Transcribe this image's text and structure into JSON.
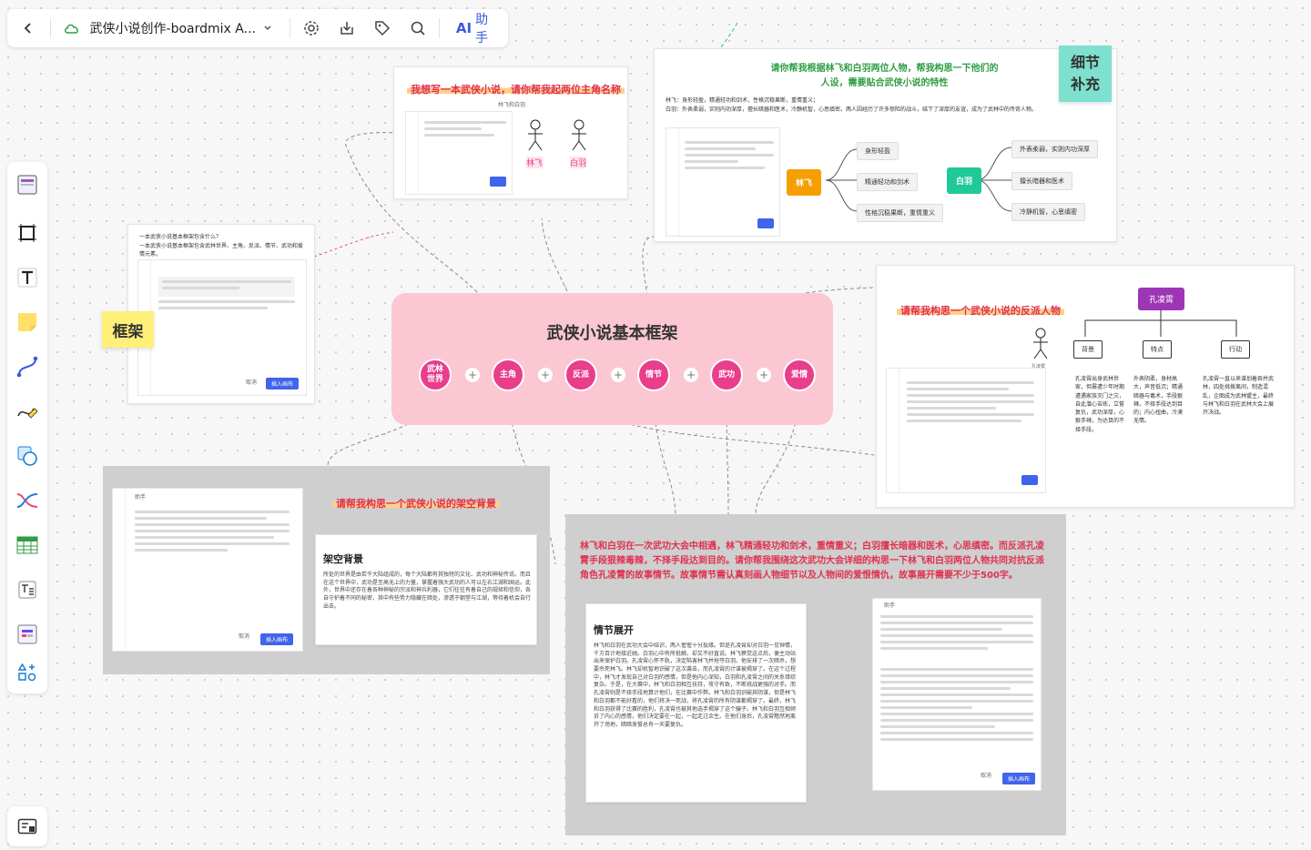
{
  "toolbar": {
    "back_icon": "chevron-left-icon",
    "cloud_icon": "cloud-icon",
    "title": "武侠小说创作-boardmix A...",
    "ai_logo": "AI",
    "ai_label": "助手"
  },
  "left_tools": [
    "template-icon",
    "frame-icon",
    "text-icon",
    "sticky-note-icon",
    "connector-icon",
    "pen-icon",
    "shape-icon",
    "mindmap-icon",
    "table-icon",
    "text-list-icon",
    "image-icon",
    "more-shapes-icon"
  ],
  "bottom_tool_icon": "map-view-icon",
  "main_frame": {
    "title": "武侠小说基本框架",
    "nodes": [
      "武林\n世界",
      "主角",
      "反派",
      "情节",
      "武功",
      "爱情"
    ],
    "plus": "+"
  },
  "sticky_kuangjia": "框架",
  "sticky_xijie": "细节\n补充",
  "card_names": {
    "highlight": "我想写一本武侠小说，请你帮我起两位主角名称",
    "subtitle": "林飞和白羽",
    "char1": "林飞",
    "char2": "白羽"
  },
  "card_framework": {
    "q1": "一本武侠小说基本框架包含什么？",
    "q2": "一本武侠小说基本框架包含武林世界、主角、反派、情节、武功和爱情元素。",
    "cancel": "取消",
    "insert": "插入画布"
  },
  "card_detail": {
    "highlight_line1": "请你帮我根据林飞和白羽两位人物，帮我构思一下他们的",
    "highlight_line2": "人设，需要贴合武侠小说的特性",
    "desc1": "林飞：身形轻盈，精通轻功和剑术，性格沉稳果断，重情重义；",
    "desc2": "白羽：外表柔弱，实则内功深厚，擅长暗器和医术，冷静机智，心思缜密。两人因经历了许多惊险的战斗，结下了深厚的友谊，成为了武林中的传奇人物。",
    "root1": "林飞",
    "root1_items": [
      "身形轻盈",
      "精通轻功和剑术",
      "性格沉稳果断，重情重义"
    ],
    "root2": "白羽",
    "root2_items": [
      "外表柔弱，实则内功深厚",
      "擅长暗器和医术",
      "冷静机智，心思缜密"
    ]
  },
  "card_villain": {
    "highlight": "请帮我构思一个武侠小说的反派人物",
    "root": "孔凌霄",
    "figure_label": "孔凌霄",
    "branches": [
      "背景",
      "特点",
      "行动"
    ],
    "texts": [
      "孔凌霄出身武林世家，但屡遭少年时期遭遇家族灭门之灾，自此潜心苦练，立誓复仇，武功深厚，心狠手辣，为达目的不择手段。",
      "外表阴柔，身材高大，声音低沉；精通暗器与毒术，手段狠辣，不择手段达到目的；内心扭曲，冷漠无情。",
      "孔凌霄一直以来谋划着吞并武林，四处挑拨离间，制造混乱，企图成为武林盟主，最终与林飞和白羽在武林大会上展开决战。"
    ]
  },
  "card_world": {
    "highlight": "请帮我构思一个武侠小说的架空背景",
    "title": "架空背景",
    "body": "所处的世界是由若干大陆组成的，每个大陆都有其独特的文化、武功和神秘传说。而且在这个世界中，武功是至高无上的力量，掌握着强大武功的人可以左右江湖和国运。此外，世界中还存在着各种神秘的宗派和神兵利器，它们往往有着自己的规矩和信仰，各自守护着不同的秘密，其中有些势力隐藏在暗处，渗透于朝堂与江湖，等待着机会自行出击。",
    "ai_label": "助手",
    "cancel": "取消",
    "insert": "插入画布"
  },
  "card_plot": {
    "prompt": "林飞和白羽在一次武功大会中相遇，林飞精通轻功和剑术，重情重义；白羽擅长暗器和医术，心思缜密。而反派孔凌霄手段狠辣毒辣，不择手段达到目的。请你帮我围绕这次武功大会详细的构思一下林飞和白羽两位人物共同对抗反派角色孔凌霄的故事情节。故事情节需认真刻画人物细节以及人物间的爱恨情仇，故事展开需要不少于500字。",
    "title": "情节展开",
    "body": "林飞和白羽在武功大会中结识，两人惺惺十分投缘。但是孔凌霄却对白羽一见钟情，千方百计地接近她。白羽心中有所抵触，却又不好直说。林飞察觉这点后，便主动站出来保护白羽。孔凌霄心怀不轨，决定陷害林飞并抢夺白羽。他安排了一次暗杀，想要杀死林飞。林飞却机智地识破了这次袭击，而孔凌霄的计谋被揭穿了。在这个过程中，林飞才发现自己对白羽的感情，但是他内心深知，白羽和孔凌霄之间的关系错综复杂。于是，在大赛中，林飞和白羽相互扶持，攻守有致，不断挑战更强的对手。而孔凌霄则是不择手段地算计他们，在比赛中作弊。林飞和白羽识破其阴谋，但是林飞和白羽都不能好看的，他们将决一死战，将孔凌霄的所有阴谋都揭穿了。最终，林飞和白羽获得了比赛的胜利，孔凌霄也被其他选手揭穿了这个骗子。林飞和白羽互相倾诉了内心的感情，他们决定要在一起，一起走过余生。在他们身后，孔凌霄黯然地离开了场地，暗暗发誓总有一天要复仇。",
    "cancel": "取消",
    "insert": "插入画布",
    "ai_label": "助手"
  }
}
